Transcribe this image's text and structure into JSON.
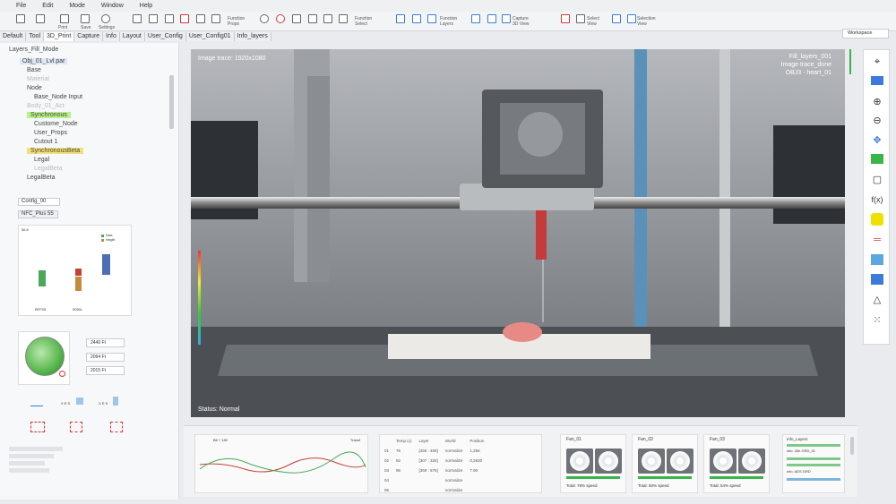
{
  "menu": [
    "File",
    "Edit",
    "Mode",
    "Window",
    "Help"
  ],
  "toolbar": {
    "function_props": "Function\nProps",
    "function_select": "Function\nSelect",
    "function_layers": "Function\nLayers",
    "capture_3d": "Capture\n3D View",
    "select_view": "Select\nView",
    "selection_view": "Selection\nView",
    "workspace": "Workspace",
    "print_lbl": "Print",
    "save_lbl": "Save",
    "settings_lbl": "Settings"
  },
  "tabs": [
    "Default",
    "Tool",
    "3D_Print",
    "Capture",
    "Info",
    "Layout",
    "User_Config",
    "User_Config01",
    "Info_layers"
  ],
  "left": {
    "title": "Layers_Fill_Mode",
    "tree": [
      {
        "label": "Obj_01_Lvl.par",
        "style": "hl",
        "indent": 0
      },
      {
        "label": "Base",
        "style": "",
        "indent": 1
      },
      {
        "label": "Material",
        "style": "faded",
        "indent": 1
      },
      {
        "label": "Node",
        "style": "",
        "indent": 1
      },
      {
        "label": "Base_Node Input",
        "style": "",
        "indent": 2
      },
      {
        "label": "Body_01_Act",
        "style": "faded",
        "indent": 1
      },
      {
        "label": "Synchronous",
        "style": "green",
        "indent": 1
      },
      {
        "label": "Custome_Node",
        "style": "",
        "indent": 2
      },
      {
        "label": "User_Props",
        "style": "",
        "indent": 2
      },
      {
        "label": "Cutout 1",
        "style": "",
        "indent": 2
      },
      {
        "label": "SynchronousBeta",
        "style": "yellow",
        "indent": 1
      },
      {
        "label": "Legal",
        "style": "",
        "indent": 2
      },
      {
        "label": "LegalBeta",
        "style": "faded",
        "indent": 2
      },
      {
        "label": "LegalBeta",
        "style": "",
        "indent": 1
      }
    ],
    "config_dd": "Config_00",
    "nfc": "NFC_Plus 55",
    "chart": {
      "corner": "56.8",
      "legend": [
        "Data",
        "Insight"
      ],
      "labels": [
        "BFP28",
        "9050L"
      ]
    },
    "fields": [
      "2440 Ft",
      "2094 Ft",
      "2015 Ft"
    ],
    "small_labels": [
      "X E S",
      "X E S"
    ]
  },
  "viewport": {
    "trace": "Image trace: 1920x1080",
    "fill": "Fill_layers_001",
    "trace_done": "Image trace_done",
    "obj": "OBJ3 - heart_01",
    "status": "Status: Normal"
  },
  "bottom": {
    "wave": {
      "title": "Bit + 180",
      "right": "Transf"
    },
    "table": {
      "headers": [
        "",
        "Temp (c)",
        "Layer",
        "World",
        "Position"
      ],
      "rows": [
        [
          "01",
          "76",
          "[456 : 468]",
          "normalize",
          "1,256"
        ],
        [
          "02",
          "82",
          "[307 : 325]",
          "normalize",
          "0,2630"
        ],
        [
          "03",
          "96",
          "[369 : 676]",
          "normalize",
          "7.90"
        ],
        [
          "04",
          "",
          "",
          "normalize",
          ""
        ],
        [
          "05",
          "",
          "",
          "normalize",
          ""
        ]
      ]
    },
    "fans": [
      {
        "name": "Fan_01",
        "total": "Total: 78% speed"
      },
      {
        "name": "Fan_02",
        "total": "Total: 50% speed"
      },
      {
        "name": "Fan_03",
        "total": "Total: 54% speed"
      }
    ],
    "info": {
      "title": "Info_Layers",
      "l1": "info: 26h GRD_01",
      "l2": "info: ADS GRD"
    }
  }
}
